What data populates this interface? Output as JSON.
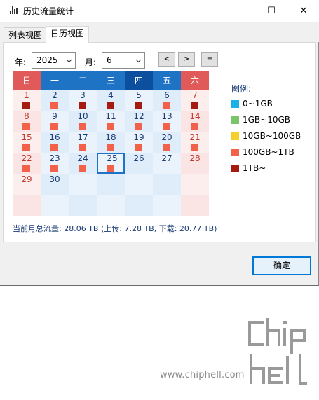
{
  "window": {
    "title": "历史流量统计",
    "controls": {
      "minimize": "—",
      "maximize": "☐",
      "close": "✕"
    }
  },
  "tabs": [
    {
      "label": "列表视图",
      "active": false
    },
    {
      "label": "日历视图",
      "active": true
    }
  ],
  "controls": {
    "year_label": "年:",
    "year_value": "2025",
    "month_label": "月:",
    "month_value": "6",
    "prev_label": "<",
    "next_label": ">",
    "menu_label": "≡"
  },
  "calendar": {
    "weekdays": [
      "日",
      "一",
      "二",
      "三",
      "四",
      "五",
      "六"
    ],
    "weekday_colors": [
      "#e05a5a",
      "#1f73c4",
      "#1f73c4",
      "#1f73c4",
      "#0c4f9e",
      "#1f73c4",
      "#e05a5a"
    ],
    "first_weekday": 0,
    "today": 25,
    "days": [
      {
        "day": "1",
        "level": 4
      },
      {
        "day": "2",
        "level": 3
      },
      {
        "day": "3",
        "level": 4
      },
      {
        "day": "4",
        "level": 4
      },
      {
        "day": "5",
        "level": 4
      },
      {
        "day": "6",
        "level": 3
      },
      {
        "day": "7",
        "level": 4
      },
      {
        "day": "8",
        "level": 3
      },
      {
        "day": "9",
        "level": 3
      },
      {
        "day": "10",
        "level": 3
      },
      {
        "day": "11",
        "level": 3
      },
      {
        "day": "12",
        "level": 3
      },
      {
        "day": "13",
        "level": 3
      },
      {
        "day": "14",
        "level": 3
      },
      {
        "day": "15",
        "level": 3
      },
      {
        "day": "16",
        "level": 3
      },
      {
        "day": "17",
        "level": 3
      },
      {
        "day": "18",
        "level": 3
      },
      {
        "day": "19",
        "level": 3
      },
      {
        "day": "20",
        "level": 3
      },
      {
        "day": "21",
        "level": 3
      },
      {
        "day": "22",
        "level": 3
      },
      {
        "day": "23",
        "level": 3
      },
      {
        "day": "24",
        "level": 3
      },
      {
        "day": "25",
        "level": 3
      },
      {
        "day": "26",
        "level": null
      },
      {
        "day": "27",
        "level": null
      },
      {
        "day": "28",
        "level": null
      },
      {
        "day": "29",
        "level": null
      },
      {
        "day": "30",
        "level": null
      }
    ]
  },
  "legend": {
    "title": "图例:",
    "items": [
      {
        "label": "0~1GB",
        "color": "#1ab0e8"
      },
      {
        "label": "1GB~10GB",
        "color": "#7cc46c"
      },
      {
        "label": "10GB~100GB",
        "color": "#f5cf2a"
      },
      {
        "label": "100GB~1TB",
        "color": "#f2614a"
      },
      {
        "label": "1TB~",
        "color": "#a51b12"
      }
    ]
  },
  "summary": "当前月总流量: 28.06 TB (上传: 7.28 TB, 下载: 20.77 TB)",
  "ok_button": "确定",
  "watermark": {
    "url": "www.chiphell.com",
    "logo_top": "chip",
    "logo_bottom": "hell"
  }
}
